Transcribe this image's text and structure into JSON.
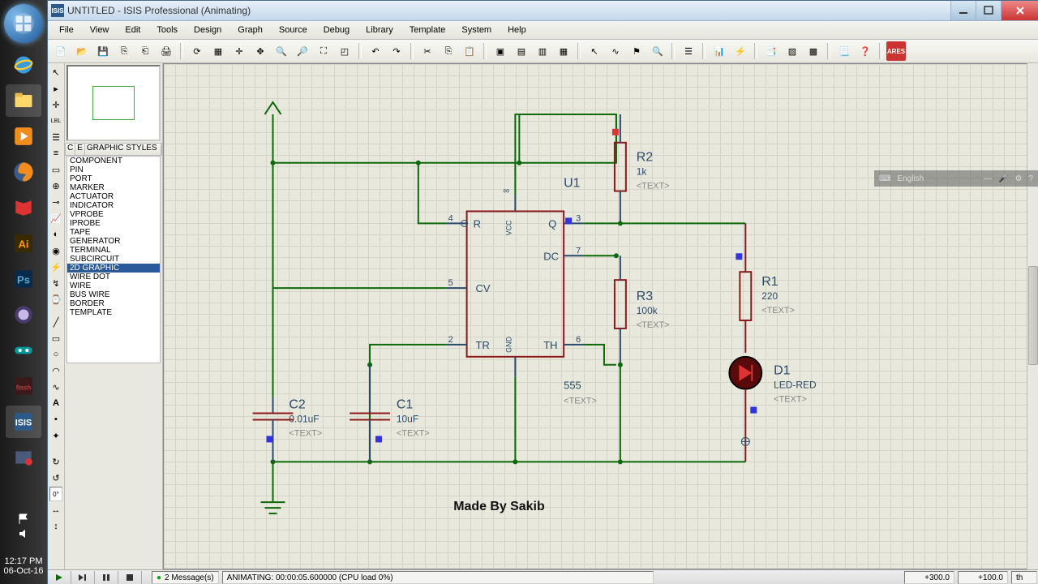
{
  "window": {
    "title": "UNTITLED - ISIS Professional (Animating)"
  },
  "menu": [
    "File",
    "View",
    "Edit",
    "Tools",
    "Design",
    "Graph",
    "Source",
    "Debug",
    "Library",
    "Template",
    "System",
    "Help"
  ],
  "sideList": {
    "header": [
      "C",
      "E",
      "GRAPHIC STYLES"
    ],
    "items": [
      "COMPONENT",
      "PIN",
      "PORT",
      "MARKER",
      "ACTUATOR",
      "INDICATOR",
      "VPROBE",
      "IPROBE",
      "TAPE",
      "GENERATOR",
      "TERMINAL",
      "SUBCIRCUIT",
      "2D GRAPHIC",
      "WIRE DOT",
      "WIRE",
      "BUS WIRE",
      "BORDER",
      "TEMPLATE"
    ],
    "selected": 12
  },
  "schem": {
    "u1": {
      "ref": "U1",
      "val": "555",
      "pins": {
        "r": "R",
        "q": "Q",
        "dc": "DC",
        "cv": "CV",
        "tr": "TR",
        "th": "TH",
        "gnd": "GND",
        "vcc": "VCC"
      },
      "nums": {
        "p4": "4",
        "p3": "3",
        "p7": "7",
        "p5": "5",
        "p2": "2",
        "p6": "6"
      }
    },
    "r1": {
      "ref": "R1",
      "val": "220",
      "txt": "<TEXT>"
    },
    "r2": {
      "ref": "R2",
      "val": "1k",
      "txt": "<TEXT>"
    },
    "r3": {
      "ref": "R3",
      "val": "100k",
      "txt": "<TEXT>"
    },
    "c1": {
      "ref": "C1",
      "val": "10uF",
      "txt": "<TEXT>"
    },
    "c2": {
      "ref": "C2",
      "val": "0.01uF",
      "txt": "<TEXT>"
    },
    "d1": {
      "ref": "D1",
      "val": "LED-RED",
      "txt": "<TEXT>"
    },
    "caption": "Made By Sakib"
  },
  "sim": {
    "messages": "2 Message(s)",
    "status": "ANIMATING: 00:00:05.600000 (CPU load 0%)",
    "coord1": "+300.0",
    "coord2": "+100.0",
    "unit": "th"
  },
  "taskbar": {
    "time": "12:17 PM",
    "date": "06-Oct-16"
  },
  "lang": {
    "label": "English"
  }
}
